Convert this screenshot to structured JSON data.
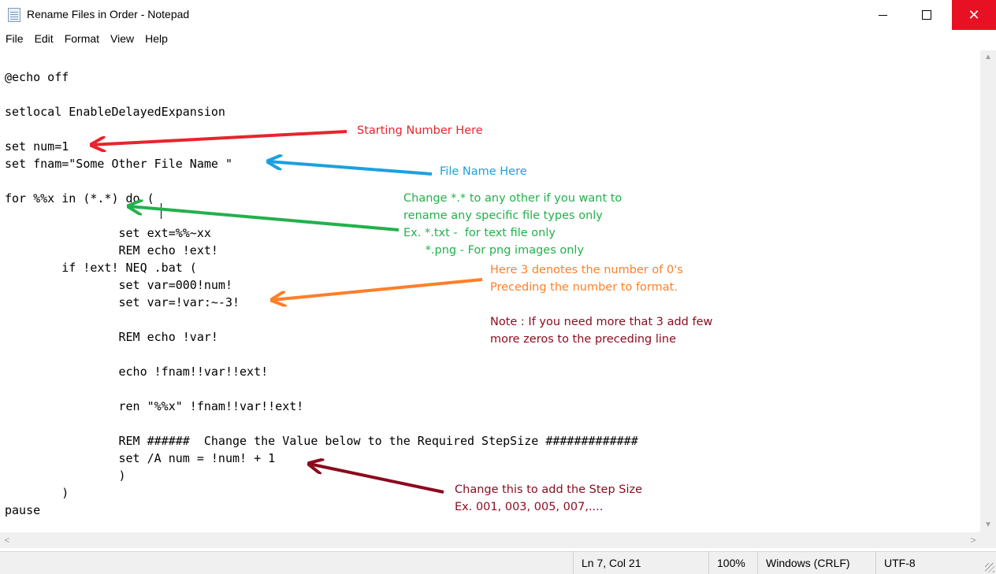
{
  "window": {
    "title": "Rename Files in Order - Notepad",
    "icon": "notepad-icon",
    "controls": {
      "minimize": "minimize-icon",
      "maximize": "maximize-icon",
      "close": "✕"
    }
  },
  "menu": [
    "File",
    "Edit",
    "Format",
    "View",
    "Help"
  ],
  "editor": {
    "text": "@echo off\n\nsetlocal EnableDelayedExpansion\n\nset num=1\nset fnam=\"Some Other File Name \"\n\nfor %%x in (*.*) do (\n\n                set ext=%%~xx\n                REM echo !ext!\n        if !ext! NEQ .bat (\n                set var=000!num!\n                set var=!var:~-3!\n\n                REM echo !var!\n\n                echo !fnam!!var!!ext!\n\n                ren \"%%x\" !fnam!!var!!ext!\n\n                REM ######  Change the Value below to the Required StepSize #############\n                set /A num = !num! + 1\n                )\n        )\npause"
  },
  "annotations": [
    {
      "text": "Starting Number Here",
      "color": "#e8242c"
    },
    {
      "text": "File Name Here",
      "color": "#1ca0e0"
    },
    {
      "text": "Change *.* to any other if you want to\nrename any specific file types only\nEx. *.txt -  for text file only\n      *.png - For png images only",
      "color": "#22b14c"
    },
    {
      "text": "Here 3 denotes the number of 0's\nPreceding the number to format.",
      "color": "#ff7f27"
    },
    {
      "text": "Note : If you need more that 3 add few\nmore zeros to the preceding line",
      "color": "#8b0a1e"
    },
    {
      "text": "Change this to add the Step Size\nEx. 001, 003, 005, 007,....",
      "color": "#8b0a1e"
    }
  ],
  "status": {
    "position": "Ln 7, Col 21",
    "zoom": "100%",
    "line_ending": "Windows (CRLF)",
    "encoding": "UTF-8"
  },
  "colors": {
    "close_button": "#e81123",
    "red_arrow": "#e8242c",
    "blue_arrow": "#1ca0e0",
    "green_arrow": "#22b14c",
    "orange_arrow": "#ff7f27",
    "maroon_arrow": "#8b0a1e"
  }
}
